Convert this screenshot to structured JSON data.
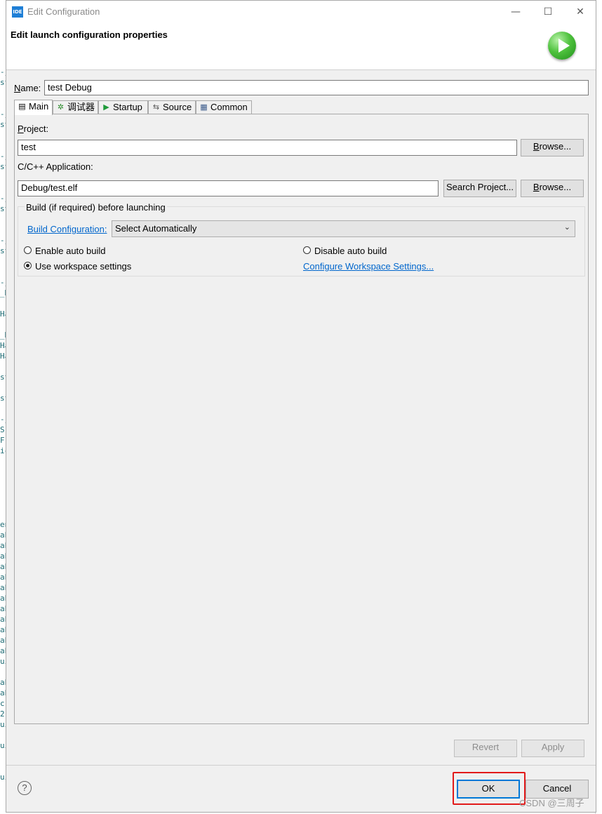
{
  "background": {
    "left_fragments": [
      "-j",
      "st",
      "",
      "",
      "-j",
      "st",
      "",
      "",
      "-j",
      "st",
      "",
      "",
      "-j",
      "st",
      "",
      "",
      "-j",
      "st",
      "",
      "",
      "-j",
      "_H",
      "",
      "Ha",
      "",
      "_H",
      "Ha",
      "Ha",
      "",
      "st",
      "",
      "st",
      "",
      "-j",
      "S",
      "F",
      "ic",
      "",
      "",
      "",
      "",
      "",
      "",
      "en",
      "ab",
      "ab",
      "ab",
      "ab",
      "ab",
      "ab",
      "ab",
      "ab",
      "ab",
      "ab",
      "ab",
      "ab",
      "ui",
      "",
      "ab",
      "ab",
      "c",
      "2",
      "ui",
      "",
      "ui",
      "",
      "",
      "ui"
    ]
  },
  "window": {
    "app_icon_text": "IDE",
    "title": "Edit Configuration",
    "minimize_glyph": "—",
    "maximize_glyph": "☐",
    "close_glyph": "✕"
  },
  "banner": {
    "title": "Edit launch configuration properties",
    "icon": "run-launch-icon"
  },
  "name_field": {
    "label": "Name:",
    "value": "test Debug"
  },
  "tabs": [
    {
      "label": "Main",
      "icon": "main-tab-icon",
      "glyph": "▤",
      "active": true
    },
    {
      "label": "调试器",
      "icon": "debugger-bug-icon",
      "glyph": "✲",
      "active": false
    },
    {
      "label": "Startup",
      "icon": "startup-play-icon",
      "glyph": "▶",
      "active": false
    },
    {
      "label": "Source",
      "icon": "source-lookup-icon",
      "glyph": "⇆",
      "active": false
    },
    {
      "label": "Common",
      "icon": "common-table-icon",
      "glyph": "▦",
      "active": false
    }
  ],
  "main_tab": {
    "project_label": "Project:",
    "project_value": "test",
    "project_browse": "Browse...",
    "app_label": "C/C++ Application:",
    "app_value": "Debug/test.elf",
    "search_project": "Search Project...",
    "app_browse": "Browse...",
    "build_group_title": "Build (if required) before launching",
    "build_config_link": "Build Configuration:",
    "build_config_value": "Select Automatically",
    "enable_auto_build": "Enable auto build",
    "disable_auto_build": "Disable auto build",
    "use_workspace_settings": "Use workspace settings",
    "configure_workspace_link": "Configure Workspace Settings...",
    "selected_option": "Use workspace settings"
  },
  "buttons": {
    "revert": "Revert",
    "apply": "Apply",
    "ok": "OK",
    "cancel": "Cancel",
    "help_glyph": "?"
  },
  "watermark": "CSDN @三周子",
  "colors": {
    "highlight_box": "#e11a1a",
    "link": "#0066cc",
    "dialog_bg": "#f0f0f0"
  }
}
